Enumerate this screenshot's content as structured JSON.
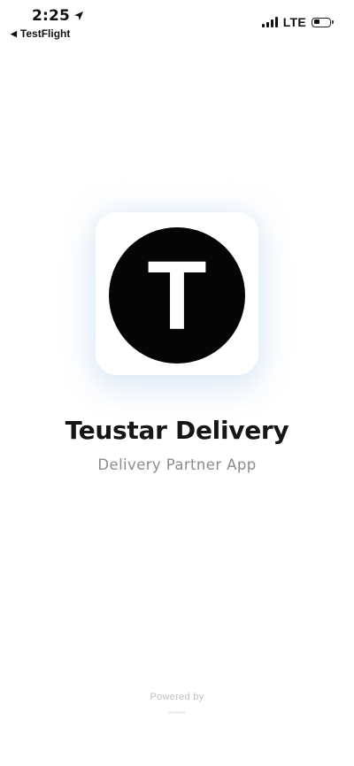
{
  "status_bar": {
    "time": "2:25",
    "location_icon": "location-arrow",
    "back_app": "TestFlight",
    "back_icon": "◀",
    "network": "LTE",
    "signal_bars": 4,
    "battery_level": 0.35
  },
  "logo": {
    "letter": "T",
    "circle_color": "#050505",
    "letter_color": "#ffffff"
  },
  "app": {
    "title": "Teustar Delivery",
    "subtitle": "Delivery Partner App"
  },
  "footer": {
    "powered_by": "Powered by",
    "vendor": "ursavior"
  }
}
